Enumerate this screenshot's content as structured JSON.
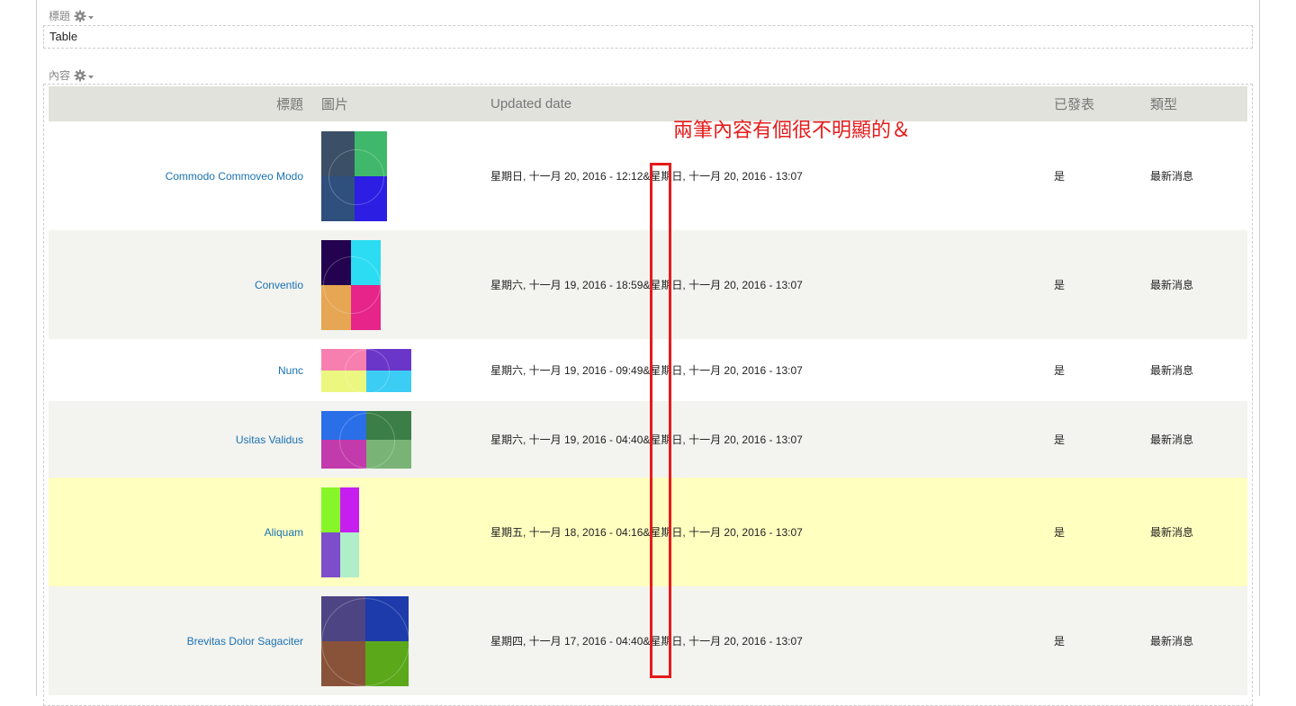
{
  "title_field": {
    "label": "標題",
    "value": "Table"
  },
  "content_field": {
    "label": "內容"
  },
  "table": {
    "headers": {
      "title": "標題",
      "image": "圖片",
      "updated": "Updated date",
      "published": "已發表",
      "type": "類型"
    },
    "rows": [
      {
        "title": "Commodo Commoveo Modo",
        "updated": "星期日, 十一月 20, 2016 - 12:12&星期日, 十一月 20, 2016 - 13:07",
        "published": "是",
        "type": "最新消息",
        "thumb_colors": [
          "#3b4f66",
          "#40b86b",
          "#2f4f7d",
          "#2c1ee3"
        ]
      },
      {
        "title": "Conventio",
        "updated": "星期六, 十一月 19, 2016 - 18:59&星期日, 十一月 20, 2016 - 13:07",
        "published": "是",
        "type": "最新消息",
        "thumb_colors": [
          "#23034f",
          "#2bdcf2",
          "#e6a653",
          "#e6248a"
        ]
      },
      {
        "title": "Nunc",
        "updated": "星期六, 十一月 19, 2016 - 09:49&星期日, 十一月 20, 2016 - 13:07",
        "published": "是",
        "type": "最新消息",
        "thumb_colors": [
          "#f77fb0",
          "#6a36c9",
          "#ecf77f",
          "#3bcdf4"
        ]
      },
      {
        "title": "Usitas Validus",
        "updated": "星期六, 十一月 19, 2016 - 04:40&星期日, 十一月 20, 2016 - 13:07",
        "published": "是",
        "type": "最新消息",
        "thumb_colors": [
          "#2a6ee8",
          "#3b7e47",
          "#c23aac",
          "#79b476"
        ]
      },
      {
        "title": "Aliquam",
        "updated": "星期五, 十一月 18, 2016 - 04:16&星期日, 十一月 20, 2016 - 13:07",
        "published": "是",
        "type": "最新消息",
        "thumb_colors": [
          "#86f52a",
          "#c71ef0",
          "#7d4dca",
          "#b0edc9"
        ]
      },
      {
        "title": "Brevitas Dolor Sagaciter",
        "updated": "星期四, 十一月 17, 2016 - 04:40&星期日, 十一月 20, 2016 - 13:07",
        "published": "是",
        "type": "最新消息",
        "thumb_colors": [
          "#4d4483",
          "#1d3bab",
          "#89533a",
          "#5ba81a"
        ]
      }
    ]
  },
  "annotation": {
    "text": "兩筆內容有個很不明顯的＆",
    "color": "#e61b1b"
  }
}
